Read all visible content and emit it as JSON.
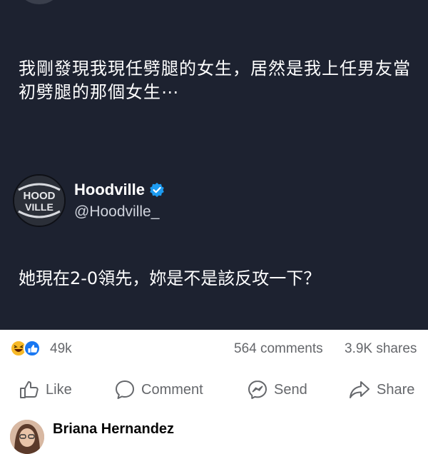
{
  "post": {
    "quote_text": "我剛發現我現任劈腿的女生，居然是我上任男友當初劈腿的那個女生⋯",
    "account": {
      "name": "Hoodville",
      "handle": "@Hoodville_",
      "avatar_text_line1": "HOOD",
      "avatar_text_line2": "VILLE"
    },
    "reply_text": "她現在2-0領先，妳是不是該反攻一下？"
  },
  "stats": {
    "reactions": "49k",
    "comments": "564 comments",
    "shares": "3.9K shares"
  },
  "actions": {
    "like": "Like",
    "comment": "Comment",
    "send": "Send",
    "share": "Share"
  },
  "comment": {
    "author": "Briana Hernandez"
  },
  "colors": {
    "post_background": "#1d2230",
    "verified_blue": "#1d9bf0",
    "like_blue": "#1877f2",
    "haha_yellow": "#f7b928"
  }
}
